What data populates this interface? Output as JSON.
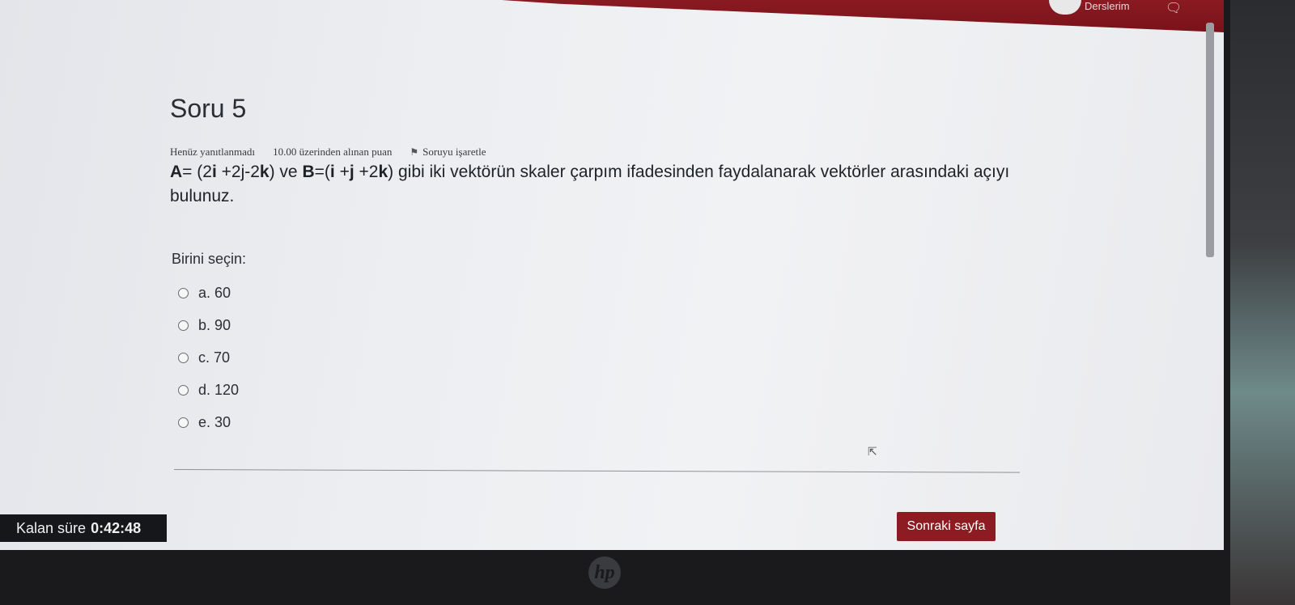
{
  "header": {
    "user_label": "Derslerim",
    "chat_icon": "chat-bubble-icon"
  },
  "question": {
    "title": "Soru 5",
    "status": "Henüz yanıtlanmadı",
    "points": "10.00 üzerinden alınan puan",
    "flag_label": "Soruyu işaretle",
    "text_parts": {
      "a_label": "A",
      "a_eq": "= (2",
      "a_i": "i",
      "a_mid": " +2j-2",
      "a_k": "k",
      "a_close": ") ve ",
      "b_label": "B",
      "b_eq": "=(",
      "b_i": "i",
      "b_mid": " +",
      "b_j": "j",
      "b_mid2": " +2",
      "b_k": "k",
      "b_close": ") gibi iki vektörün skaler çarpım ifadesinden faydalanarak vektörler arasındaki açıyı bulunuz."
    },
    "prompt": "Birini seçin:",
    "options": [
      {
        "label": "a. 60"
      },
      {
        "label": "b. 90"
      },
      {
        "label": "c. 70"
      },
      {
        "label": "d. 120"
      },
      {
        "label": "e. 30"
      }
    ]
  },
  "footer": {
    "timer_label": "Kalan süre",
    "timer_value": "0:42:48",
    "next_label": "Sonraki sayfa"
  },
  "device": {
    "logo_text": "hp"
  }
}
